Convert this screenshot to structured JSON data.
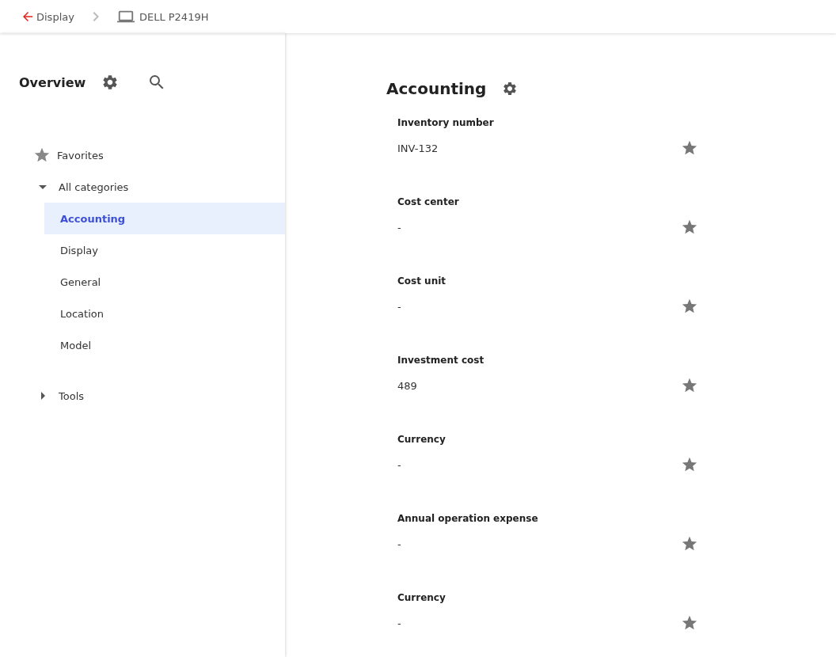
{
  "breadcrumb": {
    "back": "Display",
    "current": "DELL P2419H"
  },
  "sidebar": {
    "title": "Overview",
    "tree": [
      {
        "kind": "favorites",
        "label": "Favorites"
      },
      {
        "kind": "group",
        "label": "All categories",
        "expanded": true,
        "children": [
          {
            "label": "Accounting",
            "selected": true
          },
          {
            "label": "Display",
            "selected": false
          },
          {
            "label": "General",
            "selected": false
          },
          {
            "label": "Location",
            "selected": false
          },
          {
            "label": "Model",
            "selected": false
          }
        ]
      },
      {
        "kind": "group",
        "label": "Tools",
        "expanded": false
      }
    ]
  },
  "main": {
    "title": "Accounting",
    "fields": [
      {
        "label": "Inventory number",
        "value": "INV-132"
      },
      {
        "label": "Cost center",
        "value": "-"
      },
      {
        "label": "Cost unit",
        "value": "-"
      },
      {
        "label": "Investment cost",
        "value": "489"
      },
      {
        "label": "Currency",
        "value": "-"
      },
      {
        "label": "Annual operation expense",
        "value": "-"
      },
      {
        "label": "Currency",
        "value": "-"
      }
    ]
  }
}
